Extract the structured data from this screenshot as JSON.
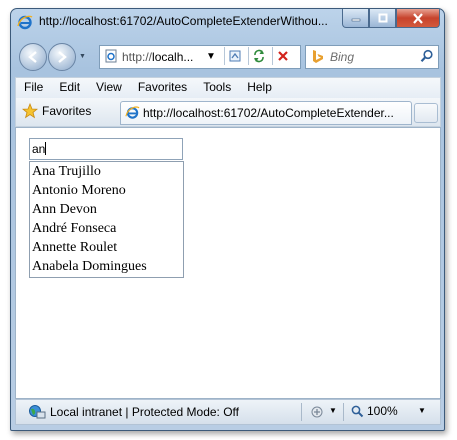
{
  "window": {
    "title": "http://localhost:61702/AutoCompleteExtenderWithou...",
    "controls": [
      "minimize-button",
      "maximize-button",
      "close-button"
    ]
  },
  "address_bar": {
    "url_prefix": "http://",
    "url_host": "localh...",
    "search_placeholder": "Bing"
  },
  "menu": {
    "items": [
      "File",
      "Edit",
      "View",
      "Favorites",
      "Tools",
      "Help"
    ]
  },
  "favorites_bar": {
    "favorites_label": "Favorites",
    "tab_title": "http://localhost:61702/AutoCompleteExtender..."
  },
  "page": {
    "input_value": "an",
    "suggestions": [
      "Ana Trujillo",
      "Antonio Moreno",
      "Ann Devon",
      "André Fonseca",
      "Annette Roulet",
      "Anabela Domingues"
    ]
  },
  "status_bar": {
    "zone_text": "Local intranet | Protected Mode: Off",
    "zoom": "100%"
  },
  "colors": {
    "close_button": "#c7432c",
    "frame": "#b8cde4"
  }
}
